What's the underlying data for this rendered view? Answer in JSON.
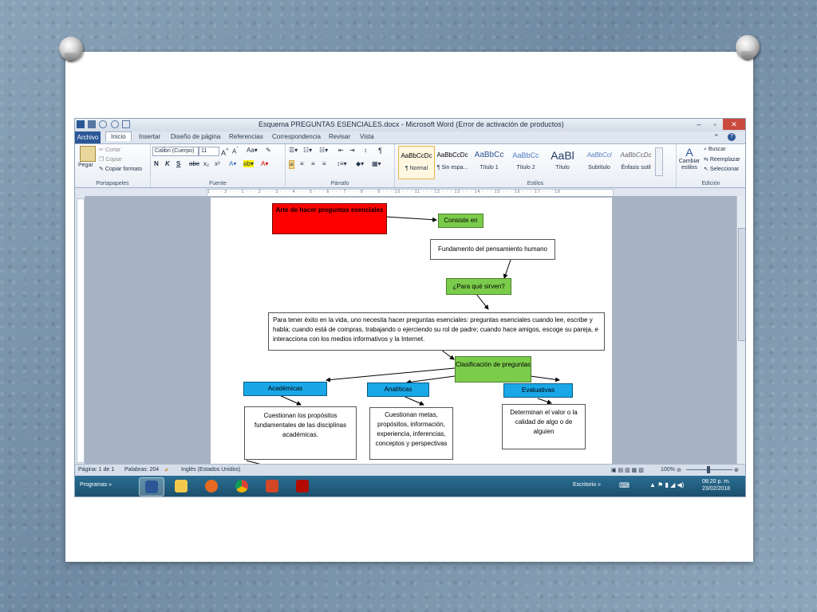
{
  "window": {
    "title": "Esquema PREGUNTAS ESENCIALES.docx - Microsoft Word (Error de activación de productos)",
    "controls": {
      "minimize": "–",
      "maximize": "▫",
      "close": "✕"
    }
  },
  "tabs": [
    {
      "label": "Archivo"
    },
    {
      "label": "Inicio"
    },
    {
      "label": "Insertar"
    },
    {
      "label": "Diseño de página"
    },
    {
      "label": "Referencias"
    },
    {
      "label": "Correspondencia"
    },
    {
      "label": "Revisar"
    },
    {
      "label": "Vista"
    }
  ],
  "ribbon": {
    "portapapeles": {
      "paste": "Pegar",
      "cut": "Cortar",
      "copy": "Copiar",
      "format_painter": "Copiar formato",
      "label": "Portapapeles"
    },
    "fuente": {
      "font": "Calibri (Cuerpo)",
      "size": "11",
      "label": "Fuente",
      "bold": "N",
      "italic": "K",
      "underline": "S"
    },
    "parrafo": {
      "label": "Párrafo",
      "pilcrow": "¶"
    },
    "estilos": {
      "label": "Estilos",
      "items": [
        {
          "sample": "AaBbCcDc",
          "name": "¶ Normal"
        },
        {
          "sample": "AaBbCcDc",
          "name": "¶ Sin espa..."
        },
        {
          "sample": "AaBbCc",
          "name": "Título 1"
        },
        {
          "sample": "AaBbCc",
          "name": "Título 2"
        },
        {
          "sample": "AaBl",
          "name": "Título"
        },
        {
          "sample": "AaBbCcl",
          "name": "Subtítulo"
        },
        {
          "sample": "AaBbCcDc",
          "name": "Énfasis sutil"
        }
      ],
      "change": "Cambiar estilos"
    },
    "edicion": {
      "label": "Edición",
      "find": "Buscar",
      "replace": "Reemplazar",
      "select": "Seleccionar"
    }
  },
  "ruler": {
    "text": "1 · · · 2 · · · 1 · · · 2 · · · 3 · · · 4 · · · 5 · · · 6 · · · 7 · · · 8 · · · 9 · · · 10 · · · 11 · · · 12 · · · 13 · · · 14 · · · 15 · · · 16 · · · 17 · · · 18"
  },
  "diagram": {
    "root": "Arte de hacer preguntas esenciales",
    "consiste": "Consiste en",
    "fundamento": "Fundamento del pensamiento humano",
    "para_que": "¿Para qué sirven?",
    "parrafo": "Para tener éxito en la vida, uno necesita hacer preguntas esenciales: preguntas esenciales cuando lee, escribe y habla; cuando está de compras, trabajando o ejerciendo su rol de padre; cuando hace amigos, escoge su pareja, e interacciona con los medios informativos y la Internet.",
    "clasificacion": "Clasificación de preguntas",
    "academicas": "Académicas",
    "analiticas": "Analíticas",
    "evaluativas": "Evaluativas",
    "academicas_desc": "Cuestionan los propósitos fundamentales de las disciplinas académicas.",
    "analiticas_desc": "Cuestionan metas, propósitos, información, experiencia, inferencias, conceptos y perspectivas",
    "evaluativas_desc": "Determinan el valor o la calidad de algo o de alguien"
  },
  "status": {
    "page": "Página: 1 de 1",
    "words": "Palabras: 204",
    "language": "Inglés (Estados Unidos)",
    "zoom": "100%"
  },
  "taskbar": {
    "start": "Programas",
    "desktop": "Escritorio",
    "time": "08:20 p. m.",
    "date": "23/02/2018"
  },
  "colors": {
    "red": "#ff0000",
    "green": "#7ccc4c",
    "blue": "#1aa7e8",
    "taskbar": "#1c4f6d"
  }
}
